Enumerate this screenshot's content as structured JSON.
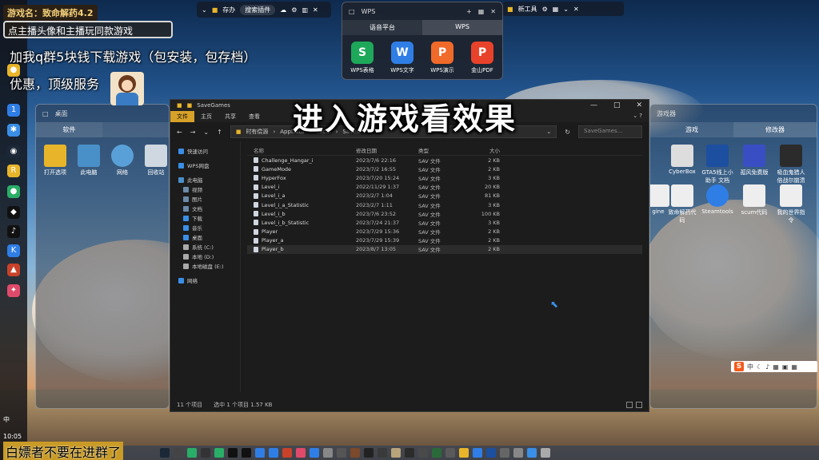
{
  "overlays": {
    "game_title": "游戏名：致命解药4.2",
    "subtitle": "点主播头像和主播玩同款游戏",
    "promo_line1": "加我q群5块钱下载游戏（包安装，包存档）",
    "promo_line2": "优惠，顶级服务",
    "big_text": "进入游戏看效果",
    "bottom_warning": "白嫖者不要在进群了"
  },
  "top_taskbar": {
    "label1": "存办",
    "search": "搜索插件"
  },
  "right_top_taskbar": {
    "label": "新工具"
  },
  "wps_window": {
    "title": "WPS",
    "tabs": [
      "语音平台",
      "WPS"
    ],
    "apps": [
      {
        "label": "WPS表格",
        "glyph": "S",
        "color": "#1ea85a"
      },
      {
        "label": "WPS文字",
        "glyph": "W",
        "color": "#2f7ee6"
      },
      {
        "label": "WPS演示",
        "glyph": "P",
        "color": "#f06a2a"
      },
      {
        "label": "金山PDF",
        "glyph": "P",
        "color": "#e8432a"
      }
    ]
  },
  "left_desktop": {
    "title": "桌面",
    "tabs": [
      "软件",
      ""
    ],
    "icons": [
      {
        "label": "打开选项"
      },
      {
        "label": "此电脑"
      },
      {
        "label": "网络"
      },
      {
        "label": "回收站"
      }
    ]
  },
  "right_desktop": {
    "title": "游戏器",
    "tabs": [
      "游戏",
      "修改器"
    ],
    "icons": [
      {
        "label": "CyberBox"
      },
      {
        "label": "GTA5线上小助手 文档1..."
      },
      {
        "label": "孤风免费版"
      },
      {
        "label": "吸血鬼猎人倍战尔崩溃"
      },
      {
        "label": "gine"
      },
      {
        "label": "致命解药代码"
      },
      {
        "label": "Steamtools"
      },
      {
        "label": "scum代码"
      },
      {
        "label": "我的世界指令"
      }
    ]
  },
  "explorer": {
    "title": "SaveGames",
    "ribbon": [
      "文件",
      "主页",
      "共享",
      "查看"
    ],
    "path": [
      "时有偿源",
      "AppData",
      "Local",
      "Saved"
    ],
    "search_placeholder": "SaveGames...",
    "sidebar": [
      {
        "label": "快速访问",
        "color": "#3a8ee6"
      },
      {
        "label": "WPS网盘",
        "color": "#3a8ee6"
      },
      {
        "label": "此电脑",
        "color": "#4a90c8"
      },
      {
        "label": "视频",
        "color": "#6a8aa8"
      },
      {
        "label": "图片",
        "color": "#6a8aa8"
      },
      {
        "label": "文档",
        "color": "#6a8aa8"
      },
      {
        "label": "下载",
        "color": "#3a8ee6"
      },
      {
        "label": "音乐",
        "color": "#3a8ee6"
      },
      {
        "label": "桌面",
        "color": "#3a8ee6"
      },
      {
        "label": "系统 (C:)",
        "color": "#aaaaaa"
      },
      {
        "label": "本地 (D:)",
        "color": "#aaaaaa"
      },
      {
        "label": "本地磁盘 (E:)",
        "color": "#aaaaaa"
      },
      {
        "label": "网络",
        "color": "#3a8ee6"
      }
    ],
    "columns": [
      "名称",
      "修改日期",
      "类型",
      "大小"
    ],
    "files": [
      {
        "name": "Challenge_Hangar_i",
        "date": "2023/7/6 22:16",
        "type": "SAV 文件",
        "size": "2 KB"
      },
      {
        "name": "GameMode",
        "date": "2023/7/2 16:55",
        "type": "SAV 文件",
        "size": "2 KB"
      },
      {
        "name": "HyperFox",
        "date": "2023/7/20 15:24",
        "type": "SAV 文件",
        "size": "3 KB"
      },
      {
        "name": "Level_i",
        "date": "2022/11/29 1:37",
        "type": "SAV 文件",
        "size": "20 KB"
      },
      {
        "name": "Level_i_a",
        "date": "2023/2/7 1:04",
        "type": "SAV 文件",
        "size": "81 KB"
      },
      {
        "name": "Level_i_a_Statistic",
        "date": "2023/2/7 1:11",
        "type": "SAV 文件",
        "size": "3 KB"
      },
      {
        "name": "Level_i_b",
        "date": "2023/7/6 23:52",
        "type": "SAV 文件",
        "size": "100 KB"
      },
      {
        "name": "Level_i_b_Statistic",
        "date": "2023/7/24 21:37",
        "type": "SAV 文件",
        "size": "3 KB"
      },
      {
        "name": "Player",
        "date": "2023/7/29 15:36",
        "type": "SAV 文件",
        "size": "2 KB"
      },
      {
        "name": "Player_a",
        "date": "2023/7/29 15:39",
        "type": "SAV 文件",
        "size": "2 KB"
      },
      {
        "name": "Player_b",
        "date": "2023/8/7 13:05",
        "type": "SAV 文件",
        "size": "2 KB"
      }
    ],
    "status": {
      "count": "11 个项目",
      "selected": "选中 1 个项目 1.57 KB"
    }
  },
  "left_bar": {
    "time": "10:05",
    "lang": "中"
  },
  "tray": {
    "lang": "中"
  }
}
